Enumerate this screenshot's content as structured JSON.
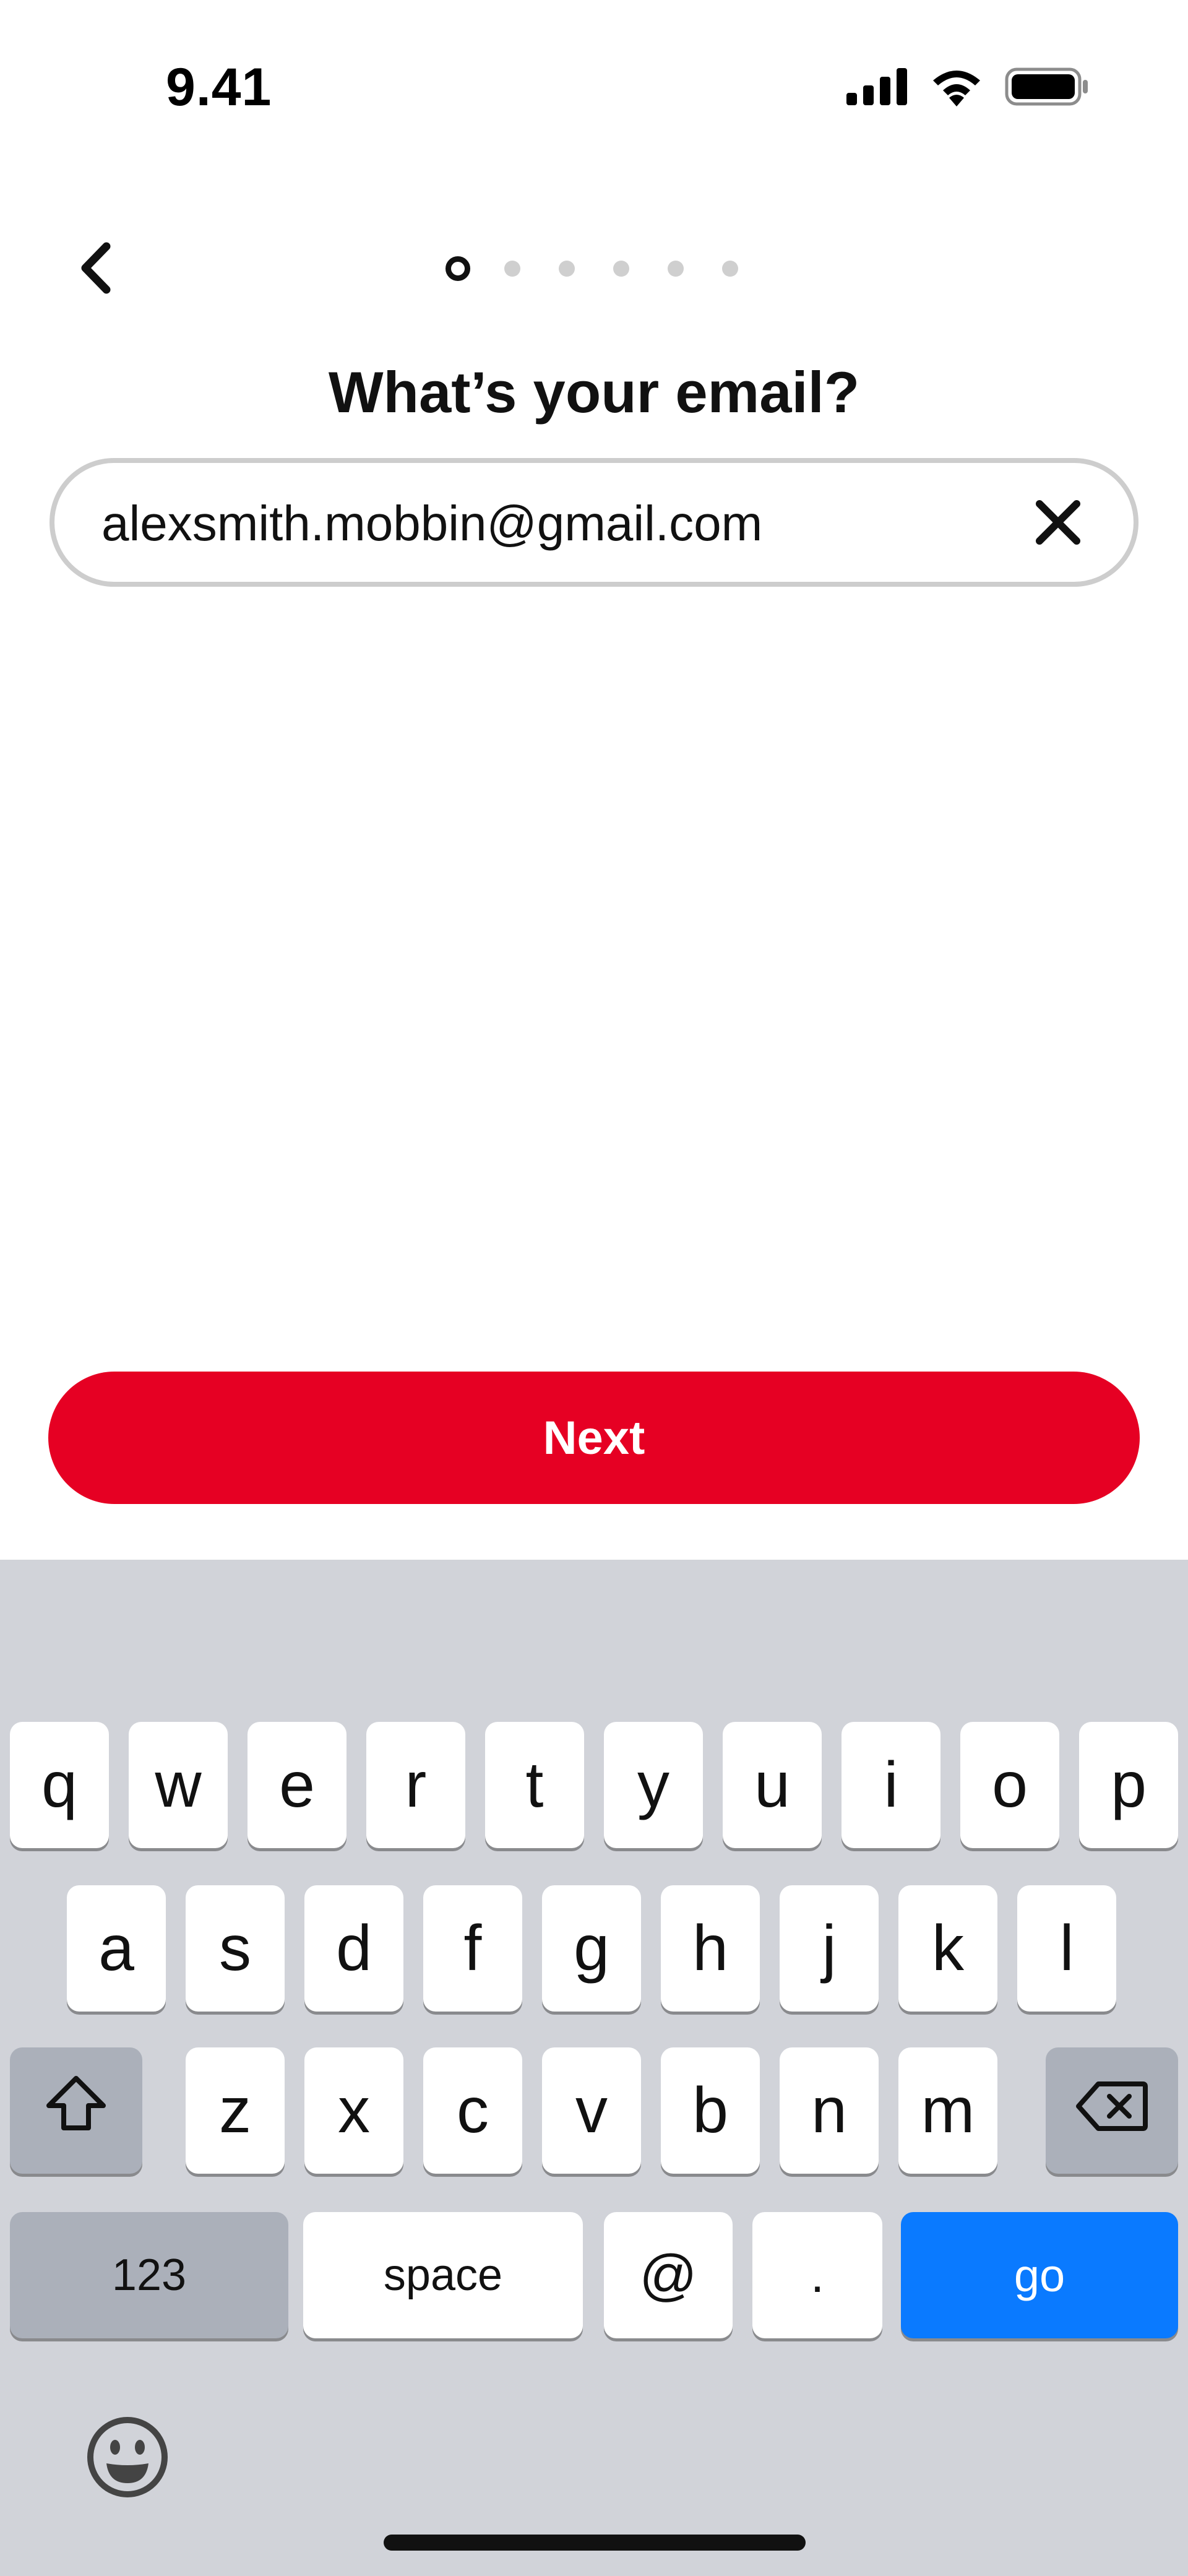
{
  "status_bar": {
    "time": "9.41"
  },
  "header": {
    "title": "What’s your email?",
    "progress": {
      "total": 6,
      "current": 1
    }
  },
  "email_field": {
    "value": "alexsmith.mobbin@gmail.com"
  },
  "next_button": {
    "label": "Next"
  },
  "keyboard": {
    "row1": [
      "q",
      "w",
      "e",
      "r",
      "t",
      "y",
      "u",
      "i",
      "o",
      "p"
    ],
    "row2": [
      "a",
      "s",
      "d",
      "f",
      "g",
      "h",
      "j",
      "k",
      "l"
    ],
    "row3": [
      "z",
      "x",
      "c",
      "v",
      "b",
      "n",
      "m"
    ],
    "numbers_label": "123",
    "space_label": "space",
    "at_label": "@",
    "dot_label": ".",
    "go_label": "go"
  },
  "colors": {
    "accent": "#e60023",
    "go_key": "#0a7aff",
    "keyboard_bg": "#d1d3d9"
  },
  "icons": {
    "back": "chevron-left-icon",
    "clear": "close-icon",
    "shift": "shift-icon",
    "delete": "backspace-icon",
    "emoji": "emoji-icon"
  }
}
